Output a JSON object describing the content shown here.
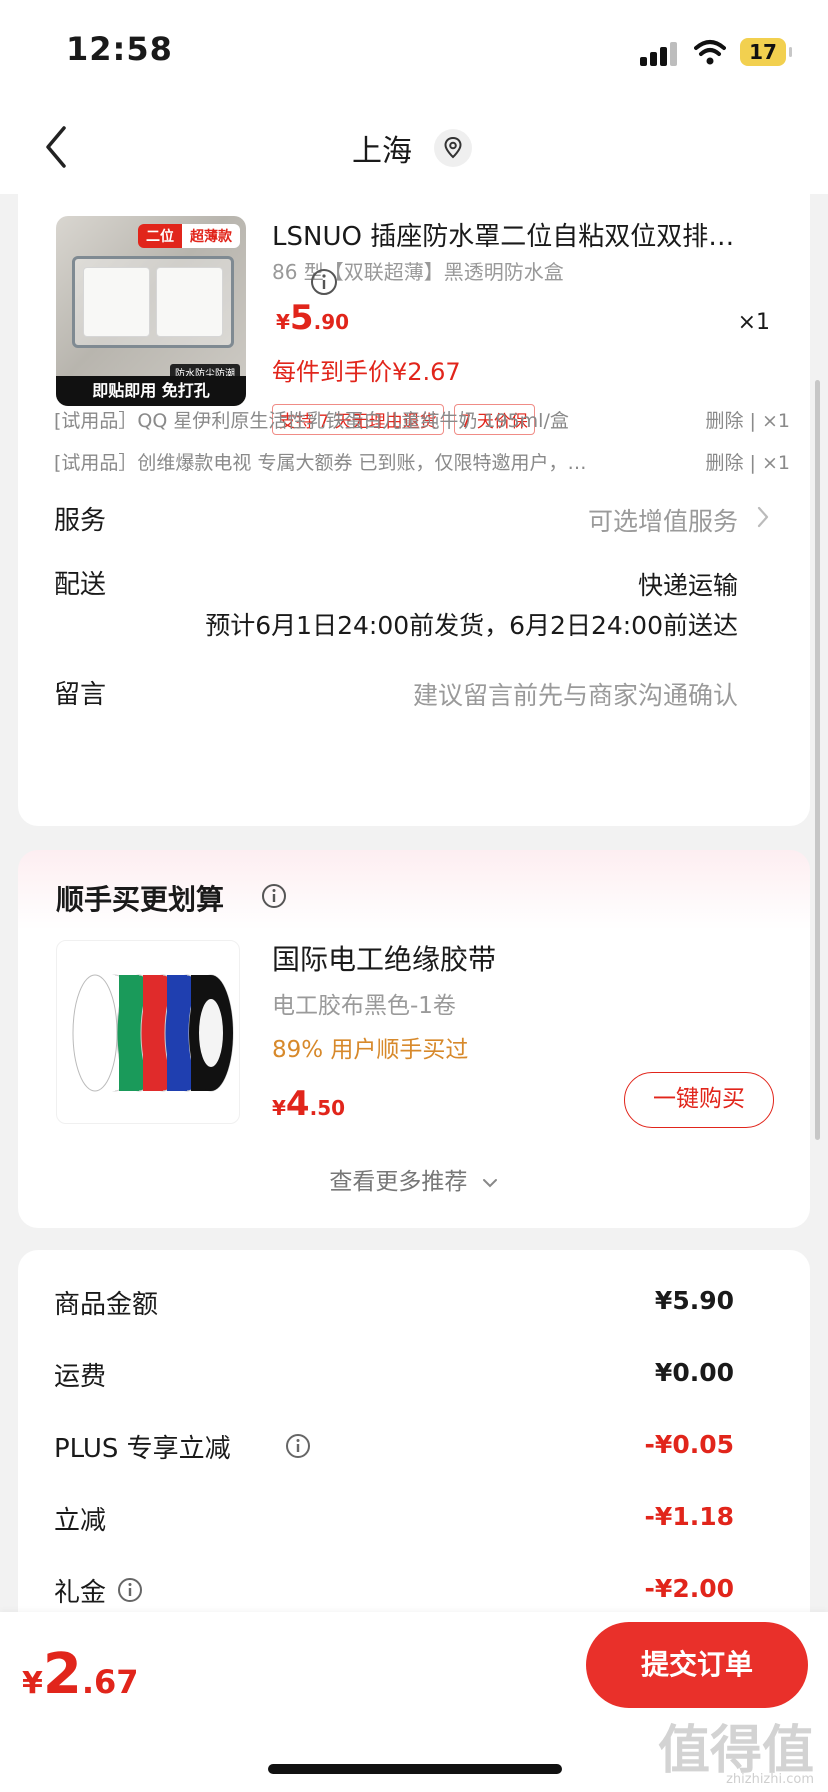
{
  "status_bar": {
    "time": "12:58",
    "battery": "17"
  },
  "nav": {
    "title": "上海"
  },
  "product": {
    "image": {
      "tag_left": "二位",
      "tag_right": "超薄款",
      "badge": "防水防尘防潮",
      "footer": "即贴即用 免打孔"
    },
    "title": "LSNUO 插座防水罩二位自粘双位双排…",
    "spec": "86 型【双联超薄】黑透明防水盒",
    "price": {
      "currency": "¥",
      "int": "5",
      "dec": ".90"
    },
    "quantity": "×1",
    "unit_price": "每件到手价¥2.67",
    "tags": [
      "支持 7 天无理由退货",
      "7 天价保"
    ]
  },
  "gifts": [
    {
      "text": "[试用品］QQ 星伊利原生活性乳铁蛋白儿童纯牛奶 195ml/盒",
      "actions": "删除 | ×1"
    },
    {
      "text": "[试用品］创维爆款电视 专属大额券 已到账，仅限特邀用户，…",
      "actions": "删除 | ×1"
    }
  ],
  "service": {
    "label": "服务",
    "value": "可选增值服务"
  },
  "delivery": {
    "label": "配送",
    "method": "快递运输",
    "estimate": "预计6月1日24:00前发货，6月2日24:00前送达"
  },
  "message": {
    "label": "留言",
    "placeholder": "建议留言前先与商家沟通确认"
  },
  "recommend": {
    "title": "顺手买更划算",
    "item": {
      "title": "国际电工绝缘胶带",
      "spec": "电工胶布黑色-1卷",
      "social": "89% 用户顺手买过",
      "price": {
        "currency": "¥",
        "int": "4",
        "dec": ".50"
      },
      "buy_label": "一键购买"
    },
    "more": "查看更多推荐"
  },
  "summary": [
    {
      "label": "商品金额",
      "value": "¥5.90",
      "info": false,
      "red": false
    },
    {
      "label": "运费",
      "value": "¥0.00",
      "info": false,
      "red": false
    },
    {
      "label": "PLUS 专享立减",
      "value": "-¥0.05",
      "info": true,
      "red": true
    },
    {
      "label": "立减",
      "value": "-¥1.18",
      "info": false,
      "red": true
    },
    {
      "label": "礼金",
      "value": "-¥2.00",
      "info": true,
      "red": true
    }
  ],
  "bottom": {
    "total": {
      "currency": "¥",
      "int": "2",
      "dec": ".67"
    },
    "submit_label": "提交订单"
  },
  "watermark": {
    "mark": "值得值",
    "site": "zhizhizhi.com"
  },
  "colors": {
    "accent": "#e1251b",
    "button": "#e9302a",
    "social": "#d7892b"
  },
  "tape_colors": [
    "#ffffff",
    "#1a9a5a",
    "#e02b2b",
    "#1f3fb0",
    "#111111"
  ]
}
